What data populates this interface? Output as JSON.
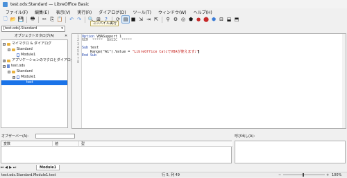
{
  "window": {
    "title": "test.ods:Standard — LibreOffice Basic"
  },
  "menubar": {
    "items": [
      "ファイル(F)",
      "編集(E)",
      "表示(V)",
      "実行(R)",
      "ダイアログ(D)",
      "ツール(T)",
      "ウィンドウ(W)",
      "ヘルプ(H)"
    ]
  },
  "toolbar": {
    "tooltip": "コンパイル実行"
  },
  "macro_selector": {
    "value": "[test.ods].Standard"
  },
  "catalog": {
    "title": "オブジェクトカタログ(A)",
    "items": [
      {
        "label": "マイマクロ & ダイアログ",
        "expander": "⊟"
      },
      {
        "label": "Standard",
        "expander": "⊟"
      },
      {
        "label": "Module1",
        "expander": ""
      },
      {
        "label": "アプリケーションのマクロとダイアログ",
        "expander": "⊞"
      },
      {
        "label": "test.ods",
        "expander": "⊟"
      },
      {
        "label": "Standard",
        "expander": "⊟"
      },
      {
        "label": "Module1",
        "expander": "⊟"
      },
      {
        "label": "test",
        "expander": ""
      }
    ]
  },
  "editor": {
    "line_numbers": [
      "1",
      "2",
      "3",
      "4",
      "5",
      "6",
      "7",
      "8"
    ],
    "code": {
      "l1_kw": "Option",
      "l1_rest": " VBASupport 1",
      "l2": "REM  *****  BASIC  *****",
      "l4_kw": "Sub",
      "l4_rest": " test",
      "l5_pre": "    Range(\"A1\").Value = ",
      "l5_str": "\"LibreOffice CalcでVBAが使えます♪\"",
      "l6": "End Sub"
    }
  },
  "watch": {
    "label": "オブザーバー(A):",
    "columns": [
      "変数",
      "値",
      "型"
    ]
  },
  "calls": {
    "label": "呼び出し(A):"
  },
  "tabs": {
    "module": "Module1"
  },
  "status": {
    "left": "test.ods.Standard.Module1.test",
    "position": "行 5, 列 49",
    "zoom": "100%"
  }
}
